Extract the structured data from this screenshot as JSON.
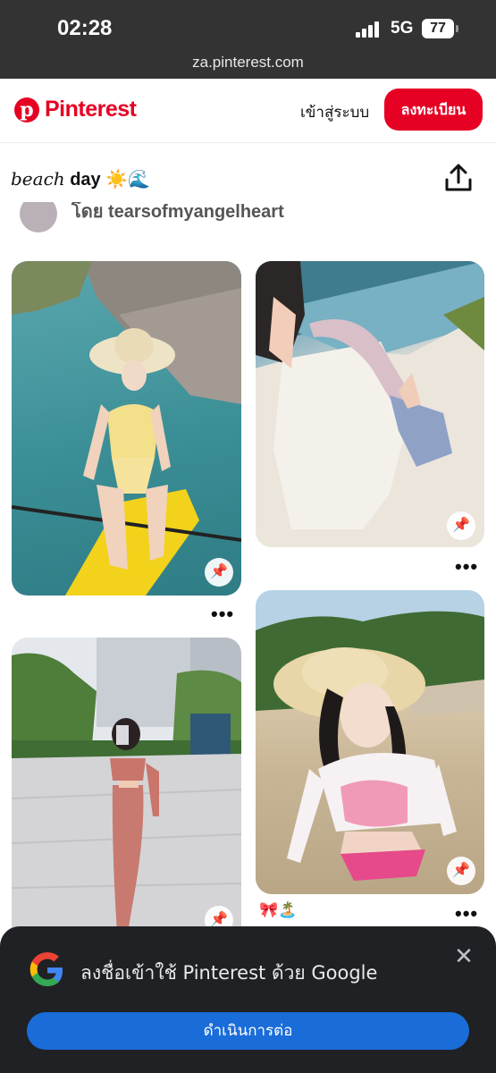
{
  "status_bar": {
    "time": "02:28",
    "network": "5G",
    "battery": "77"
  },
  "browser": {
    "url": "za.pinterest.com"
  },
  "header": {
    "logo_text": "Pinterest",
    "login_label": "เข้าสู่ระบบ",
    "signup_label": "ลงทะเบียน"
  },
  "board": {
    "title_script": "beach",
    "title_bold": "day",
    "title_emoji": "☀️🌊",
    "author": "โดย tearsofmyangelheart"
  },
  "pins": [
    {
      "more": "•••"
    },
    {
      "more": "•••"
    },
    {
      "more": "•••"
    },
    {
      "more": "•••",
      "caption": "🎀🏝️"
    }
  ],
  "google_prompt": {
    "title": "ลงชื่อเข้าใช้ Pinterest ด้วย Google",
    "continue_label": "ดำเนินการต่อ",
    "close": "✕"
  },
  "colors": {
    "brand": "#e60023",
    "google_button": "#1a6cd8",
    "sheet_bg": "#202124"
  }
}
